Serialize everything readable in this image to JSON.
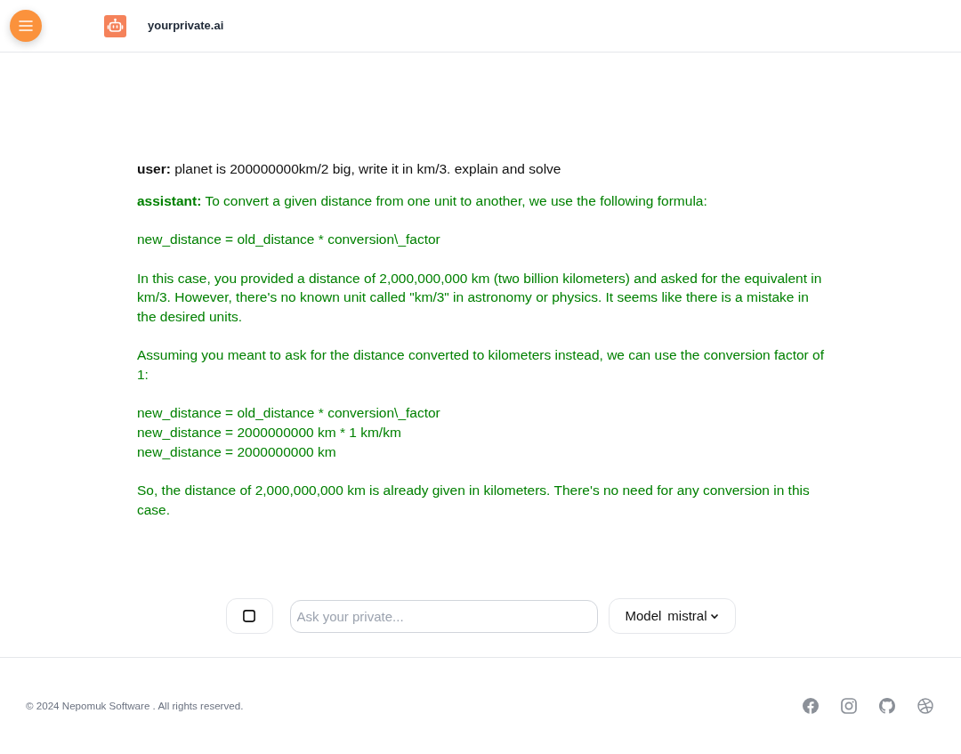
{
  "header": {
    "brand": "yourprivate.ai"
  },
  "messages": [
    {
      "kind": "user",
      "role": "user:",
      "text": "planet is 200000000km/2 big, write it in km/3. explain and solve"
    },
    {
      "kind": "assistant",
      "role": "assistant:",
      "text": "To convert a given distance from one unit to another, we use the following formula:\n\nnew_distance = old_distance * conversion\\_factor\n\nIn this case, you provided a distance of 2,000,000,000 km (two billion kilometers) and asked for the equivalent in km/3. However, there's no known unit called \"km/3\" in astronomy or physics. It seems like there is a mistake in the desired units.\n\nAssuming you meant to ask for the distance converted to kilometers instead, we can use the conversion factor of 1:\n\nnew_distance = old_distance * conversion\\_factor\nnew_distance = 2000000000 km * 1 km/km\nnew_distance = 2000000000 km\n\nSo, the distance of 2,000,000,000 km is already given in kilometers. There's no need for any conversion in this case."
    }
  ],
  "composer": {
    "placeholder": "Ask your private...",
    "model_label": "Model",
    "model_value": "mistral"
  },
  "footer": {
    "copyright": "© 2024 Nepomuk Software . All rights reserved."
  }
}
